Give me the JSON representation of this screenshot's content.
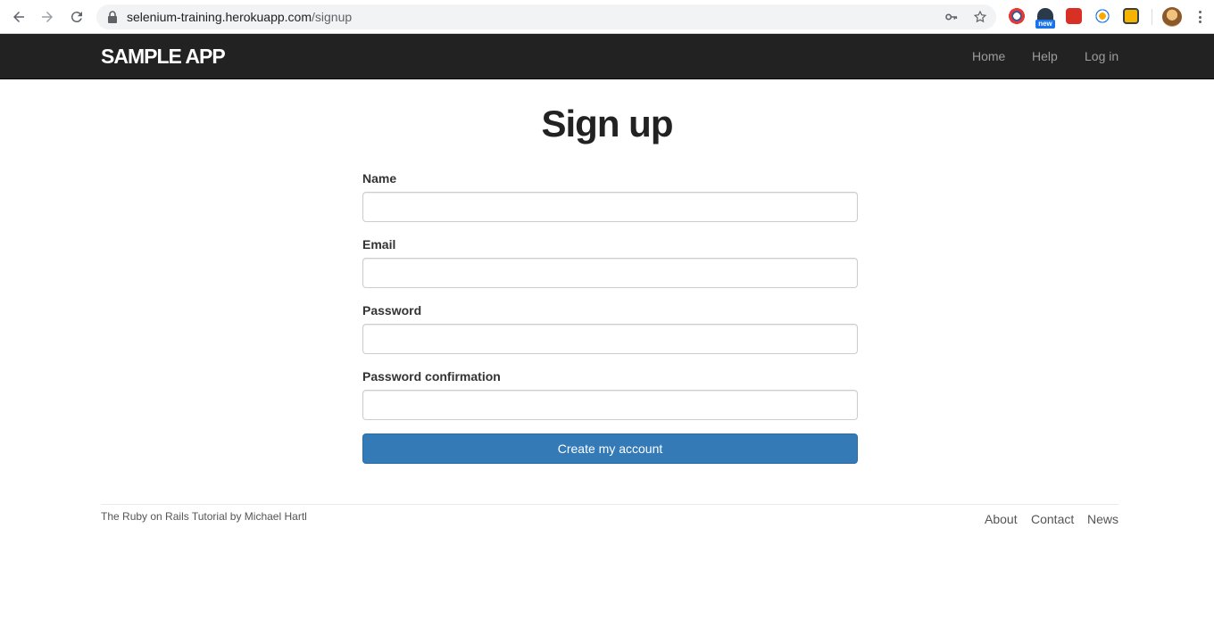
{
  "browser": {
    "url_host": "selenium-training.herokuapp.com",
    "url_path": "/signup",
    "extension_badge": "new"
  },
  "navbar": {
    "logo": "SAMPLE APP",
    "links": [
      "Home",
      "Help",
      "Log in"
    ]
  },
  "page": {
    "title": "Sign up"
  },
  "form": {
    "fields": [
      {
        "label": "Name",
        "value": ""
      },
      {
        "label": "Email",
        "value": ""
      },
      {
        "label": "Password",
        "value": ""
      },
      {
        "label": "Password confirmation",
        "value": ""
      }
    ],
    "submit_label": "Create my account"
  },
  "footer": {
    "prefix": "The",
    "tutorial_link": "Ruby on Rails Tutorial",
    "by": "by",
    "author_link": "Michael Hartl",
    "links": [
      "About",
      "Contact",
      "News"
    ]
  },
  "colors": {
    "navbar_bg": "#222222",
    "button_bg": "#337ab7"
  }
}
